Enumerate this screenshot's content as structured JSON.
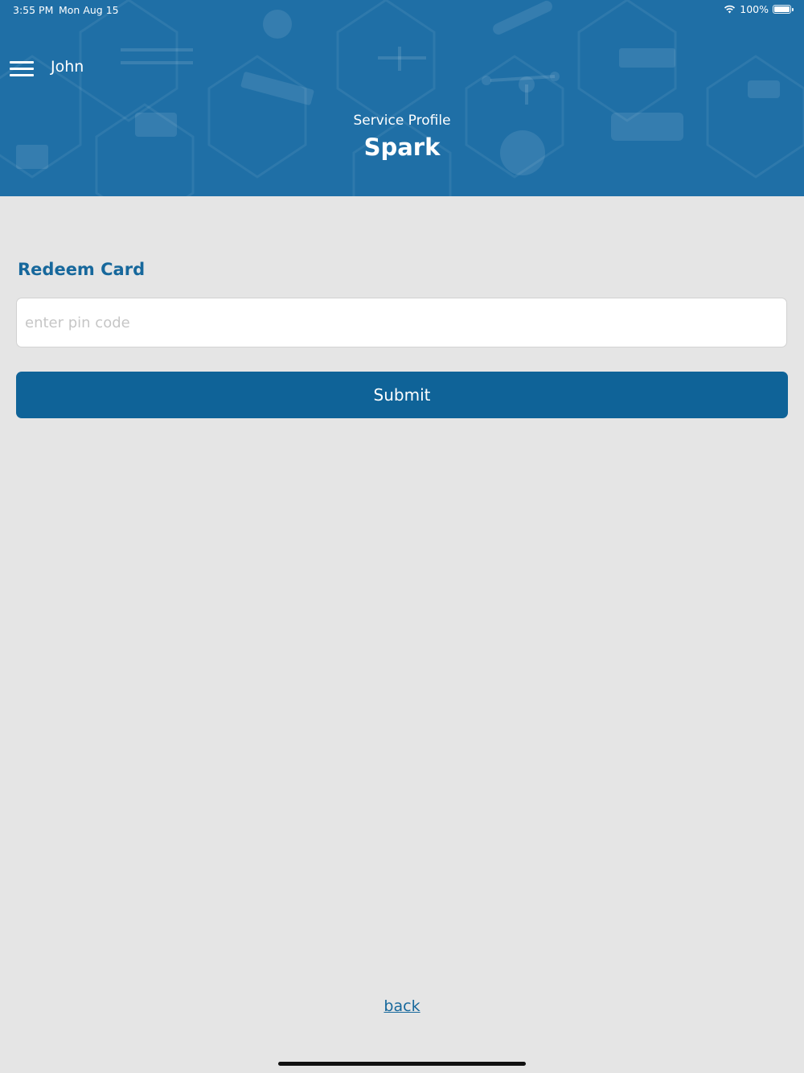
{
  "status_bar": {
    "time": "3:55 PM",
    "date": "Mon Aug 15",
    "battery": "100%",
    "battery_level": 1.0
  },
  "header": {
    "user_name": "John",
    "subtitle": "Service Profile",
    "title": "Spark",
    "background_color": "#1f6fa6"
  },
  "redeem": {
    "title": "Redeem Card",
    "pin_value": "",
    "pin_placeholder": "enter pin code",
    "submit_label": "Submit"
  },
  "footer": {
    "back_label": "back"
  },
  "colors": {
    "accent": "#17689c",
    "button": "#0f6398",
    "background": "#e5e5e5"
  },
  "icons": {
    "menu": "hamburger-menu-icon",
    "wifi": "wifi-icon",
    "battery": "battery-icon"
  }
}
